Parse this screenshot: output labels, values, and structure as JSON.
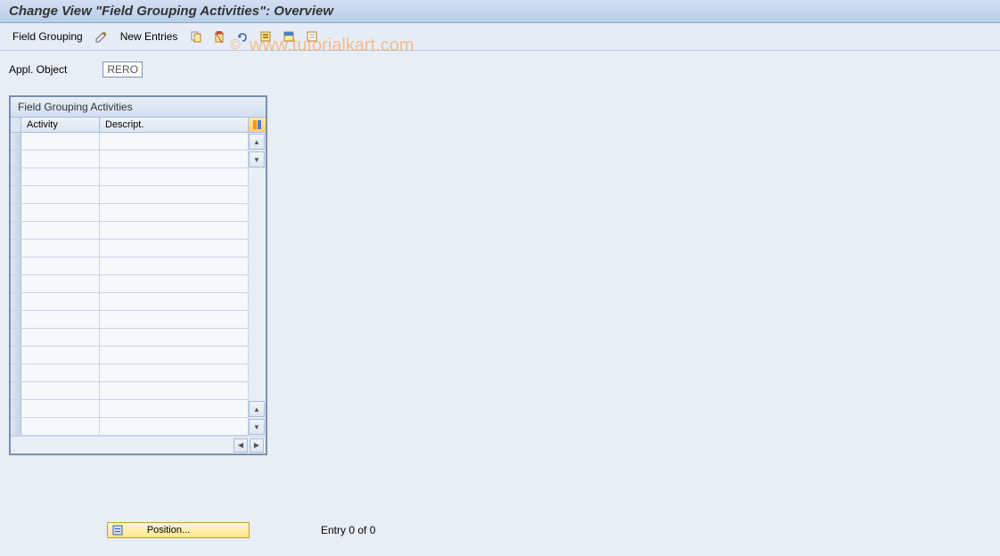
{
  "title": "Change View \"Field Grouping Activities\": Overview",
  "toolbar": {
    "field_grouping": "Field Grouping",
    "new_entries": "New Entries"
  },
  "appl_object": {
    "label": "Appl. Object",
    "value": "RERO"
  },
  "table": {
    "title": "Field Grouping Activities",
    "col_activity": "Activity",
    "col_descript": "Descript.",
    "row_count": 17
  },
  "footer": {
    "position_label": "Position...",
    "entry_text": "Entry 0 of 0"
  },
  "watermark": "www.tutorialkart.com",
  "watermark_c": "©"
}
